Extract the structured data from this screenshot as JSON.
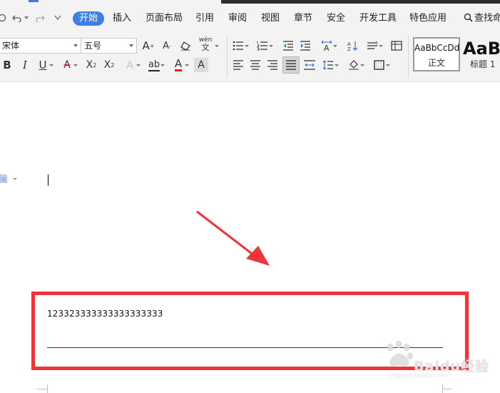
{
  "menu": {
    "items": [
      {
        "id": "start",
        "label": "开始",
        "active": true
      },
      {
        "id": "insert",
        "label": "插入"
      },
      {
        "id": "layout",
        "label": "页面布局"
      },
      {
        "id": "reference",
        "label": "引用"
      },
      {
        "id": "review",
        "label": "审阅"
      },
      {
        "id": "view",
        "label": "视图"
      },
      {
        "id": "section",
        "label": "章节"
      },
      {
        "id": "security",
        "label": "安全"
      },
      {
        "id": "devtools",
        "label": "开发工具"
      },
      {
        "id": "features",
        "label": "特色应用"
      }
    ],
    "search_label": "查找命",
    "accent_color": "#3d7fe6"
  },
  "ribbon": {
    "font_name": "宋体",
    "font_size": "五号",
    "phonetic_glyph": "wén",
    "styles": [
      {
        "sample": "AaBbCcDd",
        "name": "正文",
        "selected": true
      },
      {
        "sample": "AaBl",
        "name": "标题 1"
      }
    ]
  },
  "document": {
    "text_line": "123323333333333333333",
    "highlight_color": "#f0343b"
  },
  "watermark": {
    "text": "Baidu经验",
    "sub": "jingyan.baidu.com"
  }
}
